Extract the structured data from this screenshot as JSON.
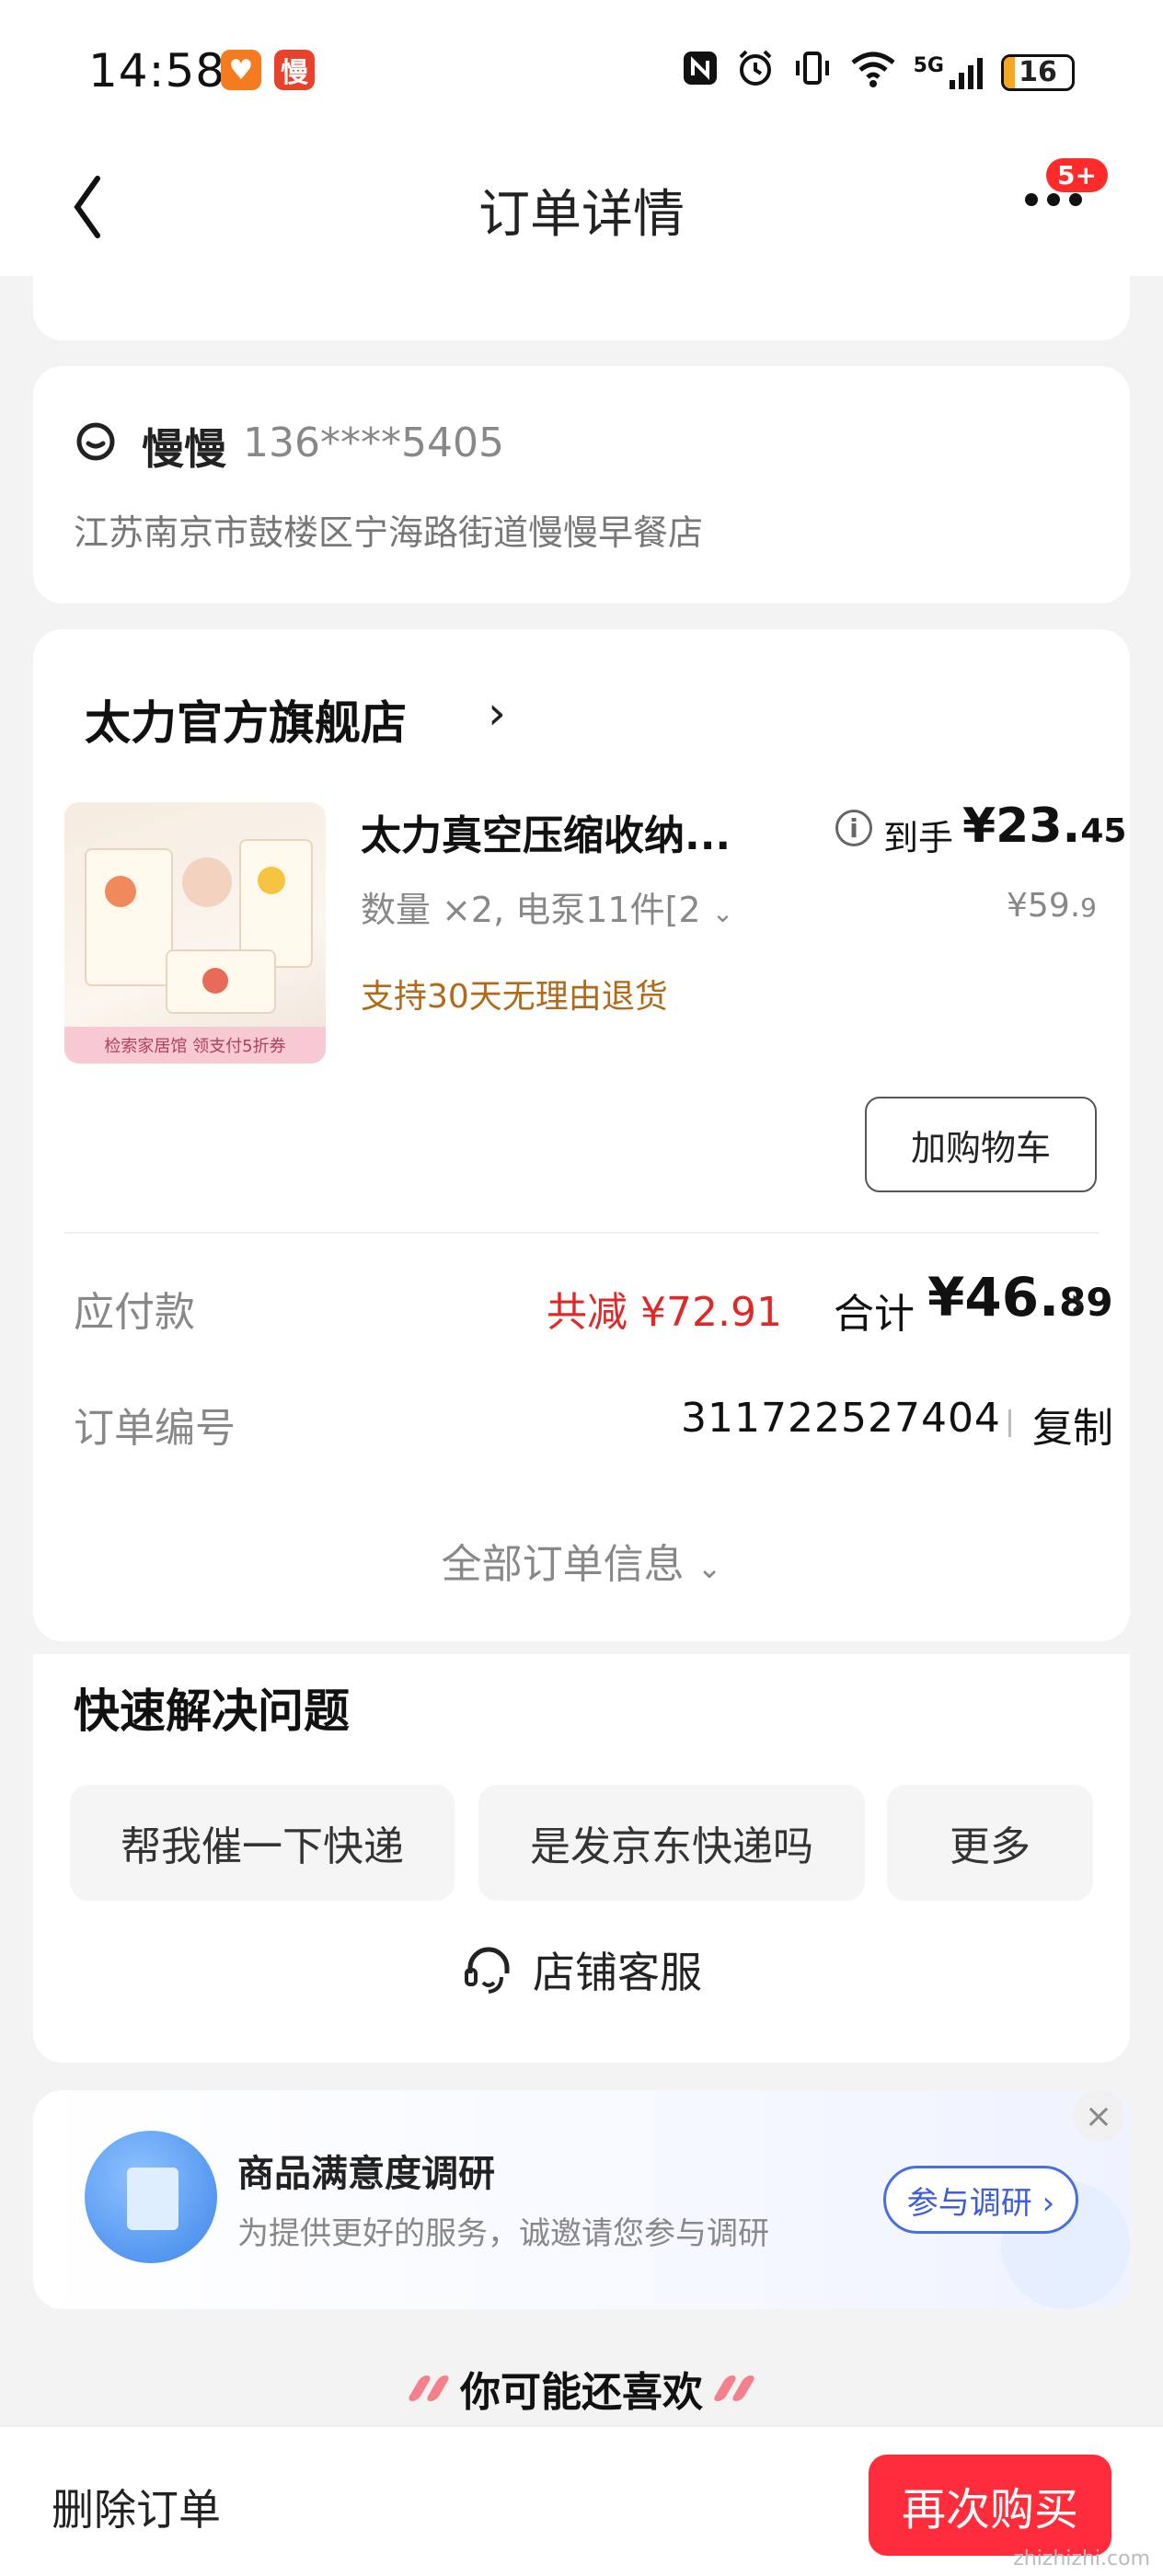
{
  "status_bar": {
    "time": "14:58",
    "app_badge_1": "♥",
    "app_badge_2": "慢",
    "icons": [
      "nfc-icon",
      "alarm-icon",
      "vibrate-icon",
      "wifi-icon",
      "signal-5g-icon"
    ],
    "network": "5G",
    "battery": "16",
    "battery_fraction": 0.16,
    "accent_colors": {
      "badge_1": "#f47b20",
      "badge_2": "#e8412c",
      "battery": "#f5a623"
    }
  },
  "nav": {
    "title": "订单详情",
    "notification_badge": "5+"
  },
  "address": {
    "name": "慢慢",
    "phone": "136****5405",
    "line": "江苏南京市鼓楼区宁海路街道慢慢早餐店"
  },
  "order": {
    "store_name": "太力官方旗舰店",
    "product": {
      "title": "太力真空压缩收纳...",
      "spec": "数量 ×2, 电泵11件[2",
      "return_policy": "支持30天无理由退货",
      "final_price_label": "到手",
      "final_price_main": "¥23.",
      "final_price_cents": "45",
      "original_price_main": "¥59.",
      "original_price_cents": "9",
      "image_banner": "检索家居馆 领支付5折券"
    },
    "add_cart_label": "加购物车",
    "payable_label": "应付款",
    "saved_text": "共减 ¥72.91",
    "total_label": "合计",
    "total_main": "¥46.",
    "total_cents": "89",
    "order_no_label": "订单编号",
    "order_no": "311722527404",
    "copy_label": "复制",
    "all_info_label": "全部订单信息"
  },
  "quick_help": {
    "title": "快速解决问题",
    "chips": [
      "帮我催一下快递",
      "是发京东快递吗",
      "更多"
    ],
    "customer_service_label": "店铺客服"
  },
  "survey": {
    "title": "商品满意度调研",
    "subtitle": "为提供更好的服务，诚邀请您参与调研",
    "button_label": "参与调研 ›",
    "close_glyph": "×"
  },
  "recommend": {
    "title": "你可能还喜欢"
  },
  "bottom_bar": {
    "delete_label": "删除订单",
    "rebuy_label": "再次购买",
    "rebuy_color": "#ff2c3c"
  },
  "watermark": "zhizhizhi.com"
}
